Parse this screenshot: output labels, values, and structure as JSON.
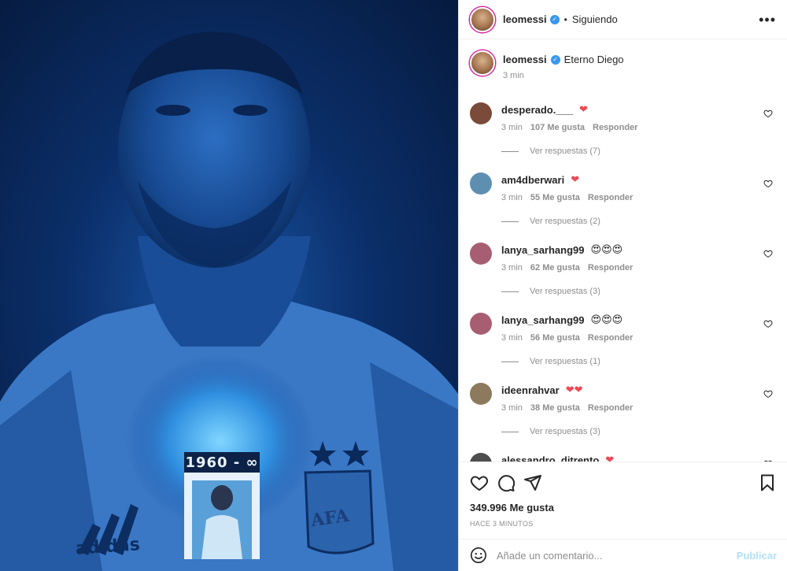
{
  "post": {
    "image_alt": "Futbolista con camiseta de Argentina bajo luz azul",
    "shirt_year": "1960 - ∞",
    "crest_text": "AFA",
    "brand_text": "adidas"
  },
  "header": {
    "username": "leomessi",
    "verified_icon": "verified-badge-icon",
    "separator": "•",
    "follow_status": "Siguiendo",
    "more_icon": "more-options-icon"
  },
  "caption": {
    "username": "leomessi",
    "text": "Eterno Diego",
    "time": "3 min"
  },
  "comments": [
    {
      "username": "desperado.___",
      "text": "❤",
      "time": "3 min",
      "likes": "107 Me gusta",
      "reply": "Responder",
      "view_replies": "Ver respuestas (7)",
      "avatar_color": "#7a4a3a"
    },
    {
      "username": "am4dberwari",
      "text": "❤",
      "time": "3 min",
      "likes": "55 Me gusta",
      "reply": "Responder",
      "view_replies": "Ver respuestas (2)",
      "avatar_color": "#5e8fb0"
    },
    {
      "username": "lanya_sarhang99",
      "text": "😍😍😍",
      "time": "3 min",
      "likes": "62 Me gusta",
      "reply": "Responder",
      "view_replies": "Ver respuestas (3)",
      "avatar_color": "#a85e72"
    },
    {
      "username": "lanya_sarhang99",
      "text": "😍😍😍",
      "time": "3 min",
      "likes": "56 Me gusta",
      "reply": "Responder",
      "view_replies": "Ver respuestas (1)",
      "avatar_color": "#a85e72"
    },
    {
      "username": "ideenrahvar",
      "text": "❤❤",
      "time": "3 min",
      "likes": "38 Me gusta",
      "reply": "Responder",
      "view_replies": "Ver respuestas (3)",
      "avatar_color": "#8d7a5c"
    },
    {
      "username": "alessandro_ditrento",
      "text": "❤",
      "time": "",
      "likes": "",
      "reply": "",
      "view_replies": "",
      "avatar_color": "#4d4d4d"
    }
  ],
  "actions": {
    "like_icon": "heart-outline-icon",
    "comment_icon": "comment-bubble-icon",
    "share_icon": "send-paper-plane-icon",
    "save_icon": "bookmark-icon",
    "likes_count": "349.996 Me gusta",
    "time_ago": "HACE 3 MINUTOS"
  },
  "add_comment": {
    "emoji_icon": "emoji-smile-icon",
    "placeholder": "Añade un comentario...",
    "publish_label": "Publicar",
    "publish_color": "#b2dffc"
  },
  "colors": {
    "photo_blue": "#0b2f6a",
    "verified_blue": "#3897f0",
    "heart_red": "#ed4956"
  }
}
